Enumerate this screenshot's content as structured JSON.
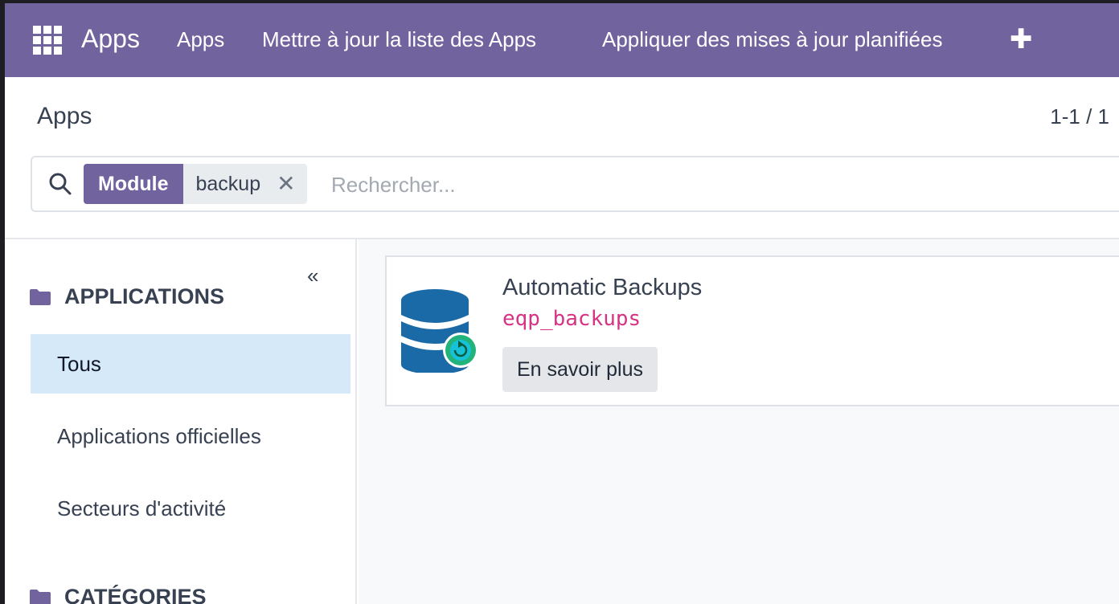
{
  "navbar": {
    "apps_menu_icon": "grid-icon",
    "brand": "Apps",
    "menu": [
      "Apps",
      "Mettre à jour la liste des Apps",
      "Appliquer des mises à jour planifiées"
    ],
    "plus_icon": "plus-icon",
    "plus_glyph": "✚",
    "color": "#71639e"
  },
  "control_panel": {
    "title": "Apps",
    "pager": "1-1 / 1"
  },
  "search": {
    "icon": "search-icon",
    "facet_label": "Module",
    "facet_value": "backup",
    "facet_remove": "✕",
    "placeholder": "Rechercher..."
  },
  "sidebar": {
    "collapse_glyph": "«",
    "applications_heading": "APPLICATIONS",
    "items": [
      {
        "label": "Tous",
        "active": true
      },
      {
        "label": "Applications officielles",
        "active": false
      },
      {
        "label": "Secteurs d'activité",
        "active": false
      }
    ],
    "categories_heading": "CATÉGORIES"
  },
  "app_card": {
    "icon": "database-backup-icon",
    "title": "Automatic Backups",
    "technical_name": "eqp_backups",
    "button": "En savoir plus"
  }
}
